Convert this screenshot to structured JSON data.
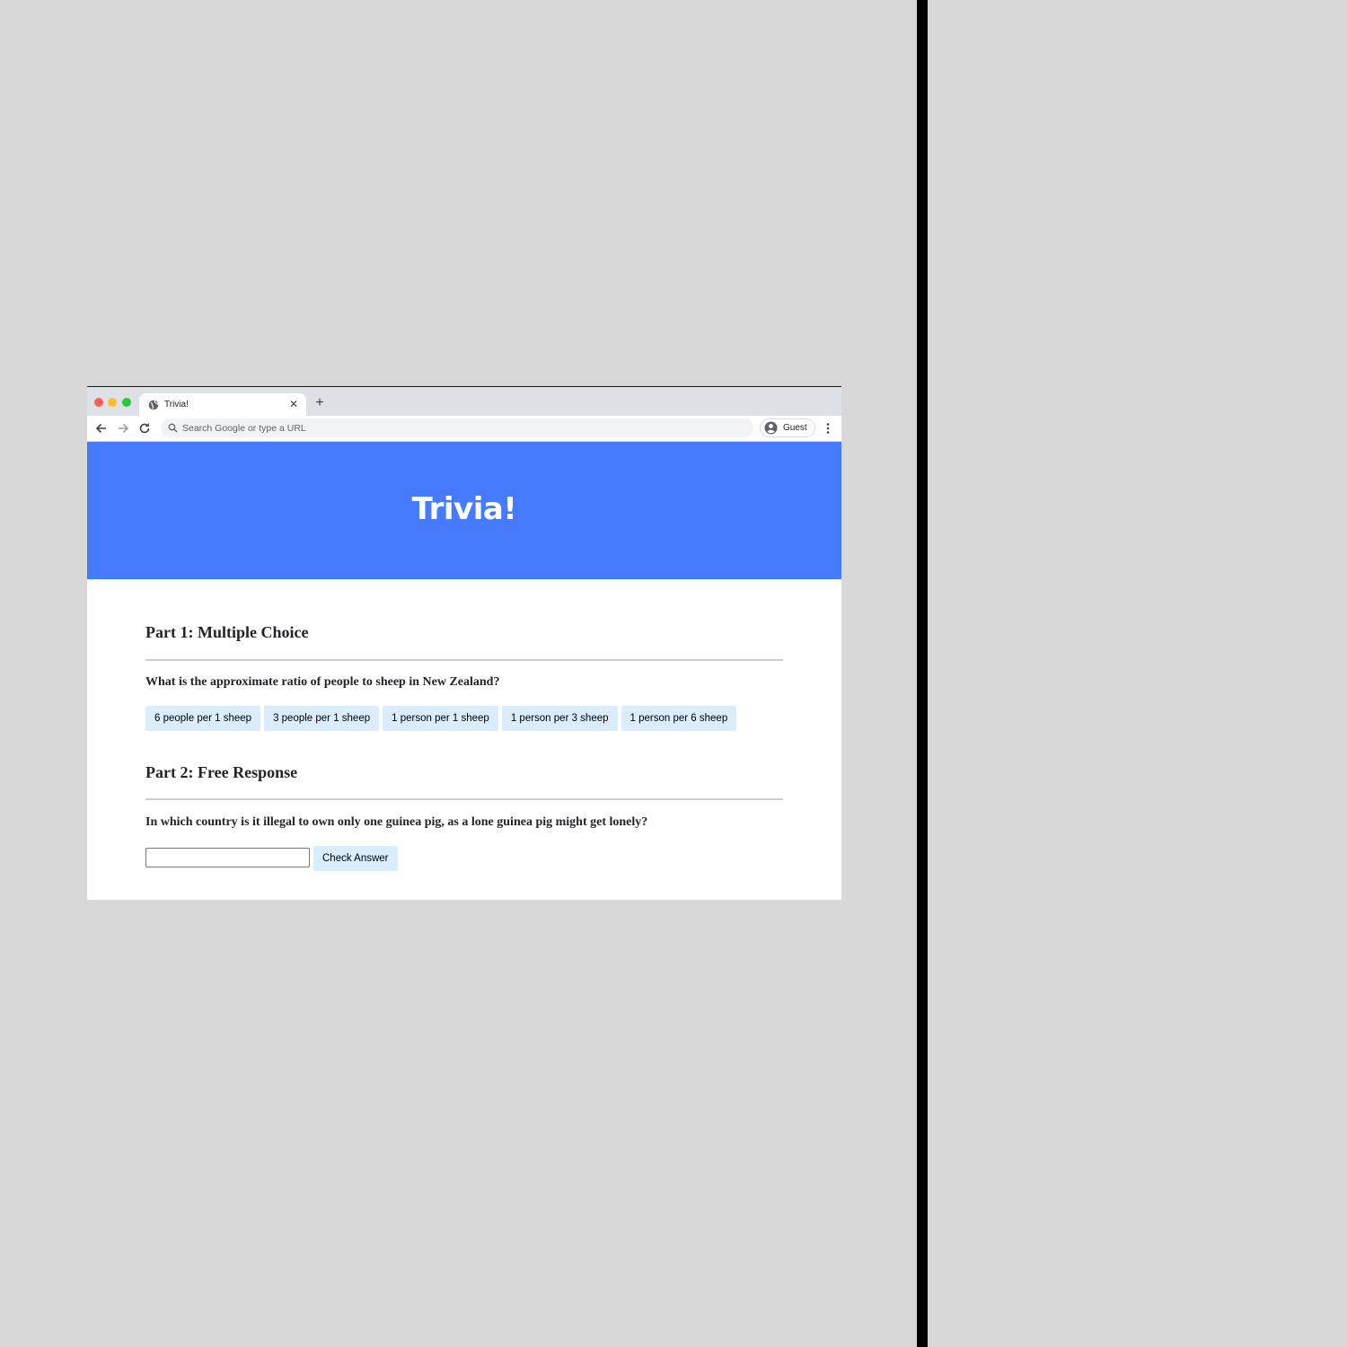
{
  "browser": {
    "tab": {
      "title": "Trivia!",
      "close_icon": "close-icon",
      "favicon": "globe-icon"
    },
    "new_tab_icon": "plus-icon",
    "toolbar": {
      "back_icon": "arrow-left-icon",
      "forward_icon": "arrow-right-icon",
      "reload_icon": "reload-icon",
      "omnibox_placeholder": "Search Google or type a URL",
      "omnibox_value": "",
      "profile_label": "Guest",
      "menu_icon": "vertical-dots-icon"
    }
  },
  "page": {
    "header_title": "Trivia!",
    "header_color": "#477bff",
    "part1": {
      "title": "Part 1: Multiple Choice",
      "question": "What is the approximate ratio of people to sheep in New Zealand?",
      "choices": [
        "6 people per 1 sheep",
        "3 people per 1 sheep",
        "1 person per 1 sheep",
        "1 person per 3 sheep",
        "1 person per 6 sheep"
      ]
    },
    "part2": {
      "title": "Part 2: Free Response",
      "question": "In which country is it illegal to own only one guinea pig, as a lone guinea pig might get lonely?",
      "answer_value": "",
      "check_label": "Check Answer"
    },
    "button_color": "#d9edff"
  }
}
